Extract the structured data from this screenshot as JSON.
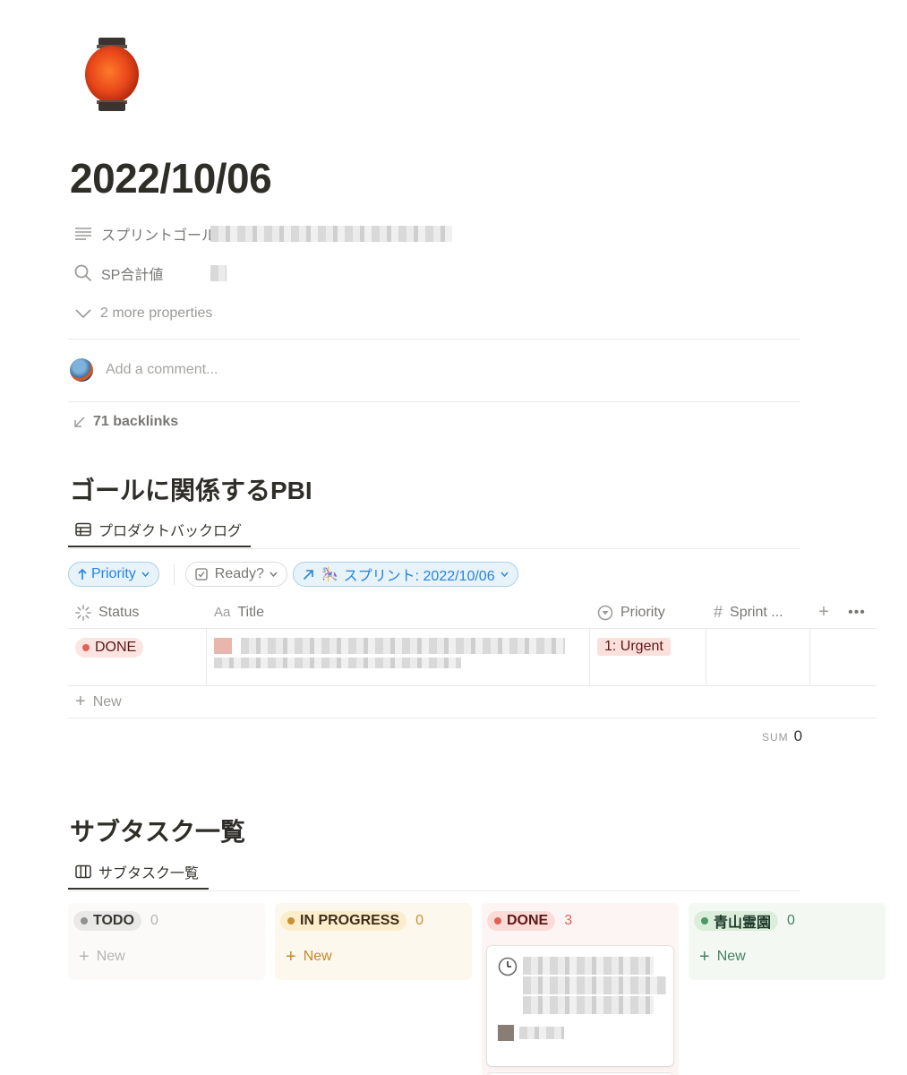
{
  "page": {
    "icon": "red-lantern",
    "title": "2022/10/06"
  },
  "properties": [
    {
      "icon": "text-lines-icon",
      "name": "スプリントゴール"
    },
    {
      "icon": "search-icon",
      "name": "SP合計値"
    }
  ],
  "more_properties": "2 more properties",
  "comment": {
    "placeholder": "Add a comment..."
  },
  "backlinks": "71 backlinks",
  "pbi_section": {
    "heading": "ゴールに関係するPBI",
    "view_tab": "プロダクトバックログ",
    "filters": {
      "sort": "Priority",
      "ready": "Ready?",
      "sprint": "スプリント: 2022/10/06"
    },
    "columns": {
      "status": "Status",
      "title": "Title",
      "priority": "Priority",
      "sprint": "Sprint ..."
    },
    "rows": [
      {
        "status": "DONE",
        "priority": "1: Urgent"
      }
    ],
    "new_label": "New",
    "sum_label": "SUM",
    "sum_value": "0"
  },
  "subtask_section": {
    "heading": "サブタスク一覧",
    "view_tab": "サブタスク一覧",
    "columns": [
      {
        "label": "TODO",
        "count": "0",
        "new": "New"
      },
      {
        "label": "IN PROGRESS",
        "count": "0",
        "new": "New"
      },
      {
        "label": "DONE",
        "count": "3"
      },
      {
        "label": "青山霊園",
        "count": "0",
        "new": "New"
      }
    ]
  },
  "colors": {
    "accent_blue": "#2383e2",
    "done_red": "#e16259",
    "progress_yellow": "#cb912f",
    "green": "#448361",
    "text": "#37352f"
  }
}
